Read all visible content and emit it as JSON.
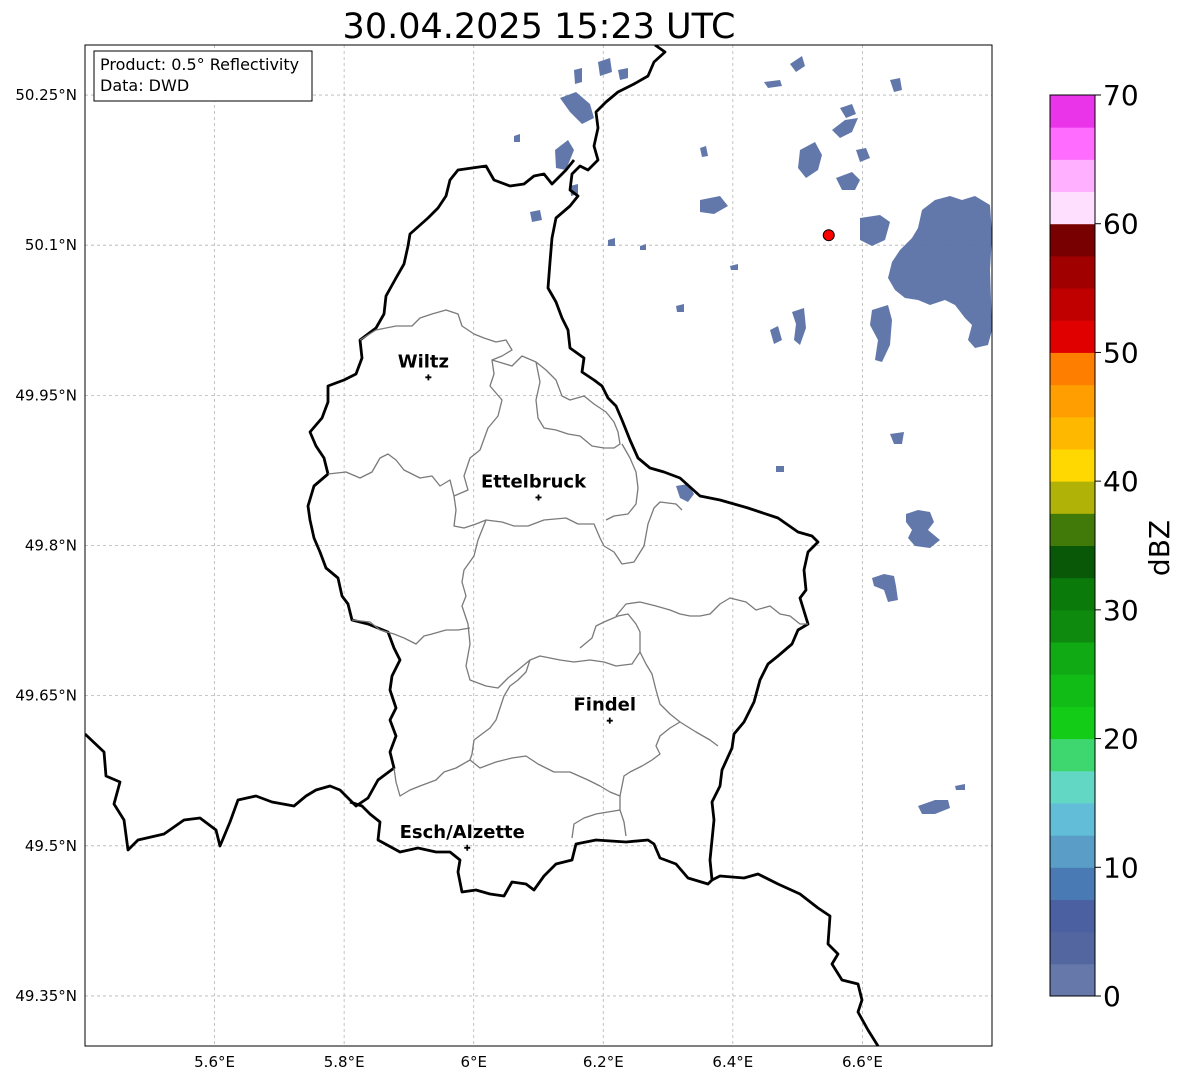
{
  "title": "30.04.2025 15:23 UTC",
  "info_box": {
    "product": "Product: 0.5° Reflectivity",
    "data_source": "Data: DWD"
  },
  "map": {
    "lon_range": [
      5.4,
      6.8
    ],
    "lat_range": [
      49.3,
      50.3
    ],
    "lon_ticks": [
      {
        "value": 5.6,
        "label": "5.6°E"
      },
      {
        "value": 5.8,
        "label": "5.8°E"
      },
      {
        "value": 6.0,
        "label": "6°E"
      },
      {
        "value": 6.2,
        "label": "6.2°E"
      },
      {
        "value": 6.4,
        "label": "6.4°E"
      },
      {
        "value": 6.6,
        "label": "6.6°E"
      }
    ],
    "lat_ticks": [
      {
        "value": 50.25,
        "label": "50.25°N"
      },
      {
        "value": 50.1,
        "label": "50.1°N"
      },
      {
        "value": 49.95,
        "label": "49.95°N"
      },
      {
        "value": 49.8,
        "label": "49.8°N"
      },
      {
        "value": 49.65,
        "label": "49.65°N"
      },
      {
        "value": 49.5,
        "label": "49.5°N"
      },
      {
        "value": 49.35,
        "label": "49.35°N"
      }
    ],
    "grid": true,
    "cities": [
      {
        "name": "Wiltz",
        "lon": 5.93,
        "lat": 49.968
      },
      {
        "name": "Ettelbruck",
        "lon": 6.1,
        "lat": 49.848
      },
      {
        "name": "Findel",
        "lon": 6.21,
        "lat": 49.625
      },
      {
        "name": "Esch/Alzette",
        "lon": 5.99,
        "lat": 49.498
      }
    ],
    "radar_site": {
      "lon": 6.548,
      "lat": 50.11,
      "color": "#ff0000"
    }
  },
  "colorbar": {
    "label": "dBZ",
    "min": 0,
    "max": 70,
    "tick_labels": [
      "0",
      "10",
      "20",
      "30",
      "40",
      "50",
      "60",
      "70"
    ],
    "colors": [
      "#6677aa",
      "#5466a0",
      "#4a60a0",
      "#4a7ab4",
      "#5a9ec8",
      "#62bed8",
      "#62d8c4",
      "#3ed66e",
      "#12cc18",
      "#12bc16",
      "#10aa14",
      "#0e8a0e",
      "#0a7a0a",
      "#085808",
      "#427a0a",
      "#b0b208",
      "#fed800",
      "#feb800",
      "#fe9e00",
      "#fe7e00",
      "#e00000",
      "#c00000",
      "#a00000",
      "#780000",
      "#fee0fe",
      "#ffb0fe",
      "#ff6cff",
      "#ea34ea"
    ]
  }
}
